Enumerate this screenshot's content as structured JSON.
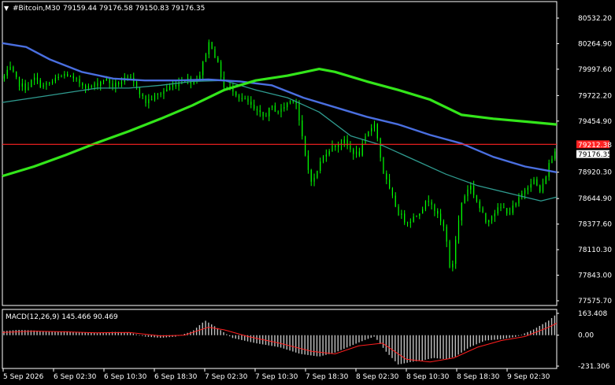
{
  "header": {
    "symbol_label": "#Bitcoin,M30",
    "ohlc": "79159.44 79176.58 79150.83 79176.35"
  },
  "colors": {
    "background": "#000000",
    "frame": "#ffffff",
    "candles": "#00ff00",
    "ma_fast": "#2f9b8f",
    "ma_mid": "#4a6fe0",
    "ma_slow": "#33e61a",
    "hline": "#ff2222",
    "price_tag_bg": "#ff2222",
    "current_tag_bg": "#ffffff",
    "histogram": "#c0c0c0",
    "signal": "#ff1e1e"
  },
  "chart_data": [
    {
      "type": "candlestick",
      "title": "#Bitcoin,M30",
      "price_axis_labels": [
        "80532.20",
        "80264.90",
        "79997.60",
        "79722.20",
        "79454.90",
        "78920.30",
        "78644.90",
        "78377.60",
        "78110.30",
        "77843.00",
        "77575.70"
      ],
      "ylim": [
        77575.7,
        80532.2
      ],
      "x_labels": [
        "5 Sep 2026",
        "6 Sep 02:30",
        "6 Sep 10:30",
        "6 Sep 18:30",
        "7 Sep 02:30",
        "7 Sep 10:30",
        "7 Sep 18:30",
        "8 Sep 02:30",
        "8 Sep 10:30",
        "8 Sep 18:30",
        "9 Sep 02:30"
      ],
      "horizontal_line": {
        "value": 79212.0,
        "label": "79212.38"
      },
      "current_price": {
        "value": 79176.35,
        "label": "79176.35"
      },
      "close_path": [
        [
          0,
          79900
        ],
        [
          5,
          80000
        ],
        [
          10,
          79850
        ],
        [
          15,
          79800
        ],
        [
          20,
          79900
        ],
        [
          25,
          79820
        ],
        [
          30,
          79850
        ],
        [
          35,
          79900
        ],
        [
          40,
          79950
        ],
        [
          45,
          79880
        ],
        [
          50,
          79850
        ],
        [
          55,
          79800
        ],
        [
          60,
          79850
        ],
        [
          65,
          79900
        ],
        [
          70,
          79820
        ],
        [
          75,
          79870
        ],
        [
          80,
          79900
        ],
        [
          85,
          79820
        ],
        [
          90,
          79650
        ],
        [
          95,
          79700
        ],
        [
          100,
          79750
        ],
        [
          105,
          79800
        ],
        [
          110,
          79850
        ],
        [
          115,
          79900
        ],
        [
          120,
          79870
        ],
        [
          125,
          79950
        ],
        [
          128,
          80150
        ],
        [
          131,
          80300
        ],
        [
          134,
          80150
        ],
        [
          137,
          80000
        ],
        [
          140,
          79800
        ],
        [
          145,
          79800
        ],
        [
          150,
          79700
        ],
        [
          155,
          79650
        ],
        [
          160,
          79550
        ],
        [
          165,
          79500
        ],
        [
          170,
          79600
        ],
        [
          175,
          79550
        ],
        [
          180,
          79650
        ],
        [
          185,
          79700
        ],
        [
          188,
          79400
        ],
        [
          192,
          79000
        ],
        [
          196,
          78800
        ],
        [
          200,
          79000
        ],
        [
          205,
          79150
        ],
        [
          210,
          79200
        ],
        [
          215,
          79250
        ],
        [
          220,
          79150
        ],
        [
          225,
          79100
        ],
        [
          230,
          79300
        ],
        [
          235,
          79450
        ],
        [
          240,
          78950
        ],
        [
          245,
          78700
        ],
        [
          250,
          78500
        ],
        [
          255,
          78400
        ],
        [
          260,
          78450
        ],
        [
          265,
          78550
        ],
        [
          270,
          78650
        ],
        [
          275,
          78450
        ],
        [
          280,
          78300
        ],
        [
          283,
          77800
        ],
        [
          286,
          78200
        ],
        [
          290,
          78600
        ],
        [
          295,
          78800
        ],
        [
          300,
          78600
        ],
        [
          305,
          78400
        ],
        [
          310,
          78500
        ],
        [
          315,
          78550
        ],
        [
          320,
          78500
        ],
        [
          325,
          78600
        ],
        [
          330,
          78750
        ],
        [
          335,
          78850
        ],
        [
          340,
          78700
        ],
        [
          345,
          79000
        ],
        [
          350,
          79176.35
        ]
      ],
      "series": [
        {
          "name": "",
          "points": [
            [
              0,
              79650
            ],
            [
              20,
              79700
            ],
            [
              40,
              79750
            ],
            [
              60,
              79800
            ],
            [
              80,
              79800
            ],
            [
              100,
              79830
            ],
            [
              120,
              79870
            ],
            [
              140,
              79880
            ],
            [
              160,
              79780
            ],
            [
              180,
              79700
            ],
            [
              200,
              79550
            ],
            [
              220,
              79300
            ],
            [
              240,
              79200
            ],
            [
              260,
              79050
            ],
            [
              280,
              78900
            ],
            [
              300,
              78780
            ],
            [
              320,
              78700
            ],
            [
              340,
              78620
            ],
            [
              350,
              78660
            ]
          ]
        },
        {
          "name": "",
          "points": [
            [
              0,
              80270
            ],
            [
              15,
              80230
            ],
            [
              30,
              80100
            ],
            [
              50,
              79970
            ],
            [
              70,
              79900
            ],
            [
              90,
              79880
            ],
            [
              110,
              79880
            ],
            [
              130,
              79890
            ],
            [
              150,
              79870
            ],
            [
              170,
              79830
            ],
            [
              190,
              79700
            ],
            [
              210,
              79600
            ],
            [
              230,
              79500
            ],
            [
              250,
              79420
            ],
            [
              270,
              79310
            ],
            [
              290,
              79220
            ],
            [
              310,
              79080
            ],
            [
              330,
              78980
            ],
            [
              350,
              78920
            ]
          ]
        },
        {
          "name": "",
          "points": [
            [
              0,
              78880
            ],
            [
              20,
              78980
            ],
            [
              40,
              79100
            ],
            [
              60,
              79230
            ],
            [
              80,
              79350
            ],
            [
              100,
              79480
            ],
            [
              120,
              79620
            ],
            [
              140,
              79780
            ],
            [
              160,
              79880
            ],
            [
              180,
              79930
            ],
            [
              200,
              80000
            ],
            [
              210,
              79970
            ],
            [
              230,
              79870
            ],
            [
              250,
              79780
            ],
            [
              270,
              79680
            ],
            [
              290,
              79520
            ],
            [
              310,
              79480
            ],
            [
              330,
              79450
            ],
            [
              350,
              79420
            ]
          ]
        }
      ],
      "xlim": [
        0,
        350
      ]
    },
    {
      "type": "bar",
      "title": "MACD(12,26,9) 145.466 90.469",
      "axis_labels": [
        "163.408",
        "0.00",
        "-231.306"
      ],
      "ylim": [
        -231.306,
        163.408
      ],
      "histogram_path": [
        [
          0,
          30
        ],
        [
          10,
          40
        ],
        [
          20,
          35
        ],
        [
          30,
          25
        ],
        [
          40,
          30
        ],
        [
          50,
          20
        ],
        [
          60,
          15
        ],
        [
          70,
          25
        ],
        [
          80,
          20
        ],
        [
          90,
          -10
        ],
        [
          100,
          -20
        ],
        [
          110,
          -10
        ],
        [
          120,
          30
        ],
        [
          128,
          110
        ],
        [
          135,
          60
        ],
        [
          145,
          -20
        ],
        [
          160,
          -60
        ],
        [
          175,
          -90
        ],
        [
          188,
          -140
        ],
        [
          200,
          -160
        ],
        [
          210,
          -130
        ],
        [
          220,
          -80
        ],
        [
          228,
          -40
        ],
        [
          235,
          -10
        ],
        [
          242,
          -120
        ],
        [
          250,
          -220
        ],
        [
          258,
          -200
        ],
        [
          265,
          -190
        ],
        [
          272,
          -170
        ],
        [
          280,
          -180
        ],
        [
          286,
          -160
        ],
        [
          295,
          -90
        ],
        [
          305,
          -40
        ],
        [
          315,
          -30
        ],
        [
          325,
          -10
        ],
        [
          335,
          40
        ],
        [
          345,
          110
        ],
        [
          350,
          160
        ]
      ],
      "signal_path": [
        [
          0,
          20
        ],
        [
          20,
          30
        ],
        [
          40,
          25
        ],
        [
          60,
          18
        ],
        [
          80,
          20
        ],
        [
          100,
          -5
        ],
        [
          115,
          0
        ],
        [
          130,
          60
        ],
        [
          140,
          40
        ],
        [
          155,
          -10
        ],
        [
          175,
          -60
        ],
        [
          195,
          -120
        ],
        [
          210,
          -140
        ],
        [
          225,
          -80
        ],
        [
          240,
          -60
        ],
        [
          255,
          -180
        ],
        [
          270,
          -200
        ],
        [
          285,
          -170
        ],
        [
          300,
          -90
        ],
        [
          315,
          -40
        ],
        [
          330,
          -10
        ],
        [
          345,
          60
        ],
        [
          350,
          90
        ]
      ],
      "xlim": [
        0,
        350
      ]
    }
  ]
}
